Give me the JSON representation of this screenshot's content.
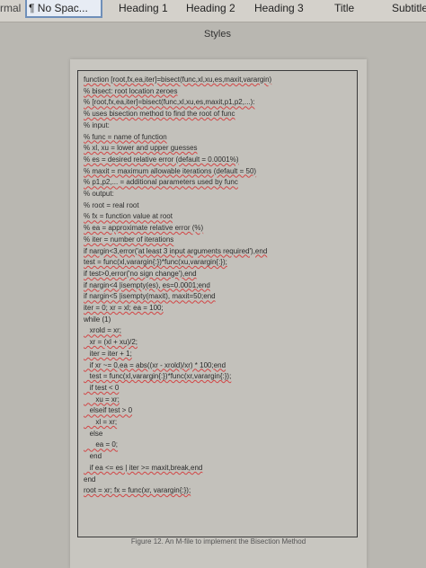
{
  "ribbon": {
    "styles": [
      {
        "label": "¶ No Spac...",
        "selected": true
      },
      {
        "label": "Heading 1",
        "selected": false
      },
      {
        "label": "Heading 2",
        "selected": false
      },
      {
        "label": "Heading 3",
        "selected": false
      },
      {
        "label": "Title",
        "selected": false
      },
      {
        "label": "Subtitle",
        "selected": false
      }
    ],
    "styles_group_label": "Styles",
    "left_fragment": "rmal"
  },
  "document": {
    "code_lines": [
      "function [root,fx,ea,iter]=bisect(func,xl,xu,es,maxit,varargin)",
      "% bisect: root location zeroes",
      "% [root,fx,ea,iter]=bisect(func,xl,xu,es,maxit,p1,p2,...):",
      "% uses bisection method to find the root of func",
      "% input:",
      "% func = name of function",
      "% xl, xu = lower and upper guesses",
      "% es = desired relative error (default = 0.0001%)",
      "% maxit = maximum allowable iterations (default = 50)",
      "% p1,p2,... = additional parameters used by func",
      "% output:",
      "% root = real root",
      "% fx = function value at root",
      "% ea = approximate relative error (%)",
      "% iter = number of iterations",
      "if nargin<3,error('at least 3 input arguments required'),end",
      "test = func(xl,varargin{:})*func(xu,varargin{:});",
      "if test>0,error('no sign change'),end",
      "if nargin<4 |isempty(es), es=0.0001;end",
      "if nargin<5 |isempty(maxit), maxit=50;end",
      "iter = 0; xr = xl; ea = 100;",
      "while (1)",
      "   xrold = xr;",
      "   xr = (xl + xu)/2;",
      "   iter = iter + 1;",
      "   if xr ~= 0,ea = abs((xr - xrold)/xr) * 100;end",
      "   test = func(xl,varargin{:})*func(xr,varargin{:});",
      "   if test < 0",
      "      xu = xr;",
      "   elseif test > 0",
      "      xl = xr;",
      "   else",
      "      ea = 0;",
      "   end",
      "   if ea <= es | iter >= maxit,break,end",
      "end",
      "root = xr; fx = func(xr, varargin{:});"
    ],
    "caption": "Figure 12. An M-file to implement the Bisection Method"
  }
}
